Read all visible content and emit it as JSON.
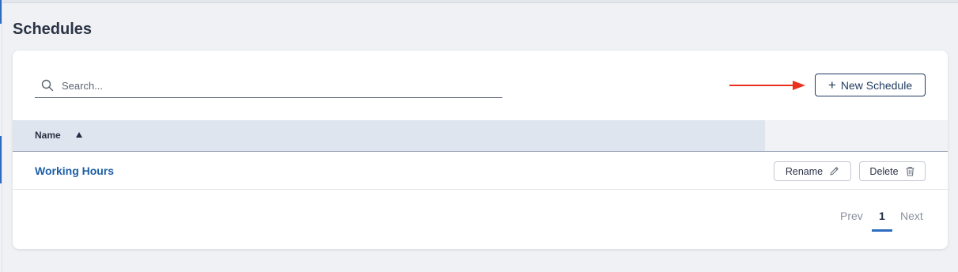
{
  "page": {
    "title": "Schedules"
  },
  "search": {
    "placeholder": "Search...",
    "value": ""
  },
  "toolbar": {
    "new_schedule_label": "New Schedule"
  },
  "table": {
    "columns": [
      {
        "label": "Name",
        "sort": "ascending"
      }
    ],
    "rows": [
      {
        "name": "Working Hours",
        "rename_label": "Rename",
        "delete_label": "Delete"
      }
    ]
  },
  "pagination": {
    "prev_label": "Prev",
    "current_page": "1",
    "next_label": "Next"
  },
  "colors": {
    "accent": "#2d6cc0",
    "link": "#1d5fa6",
    "annotation_arrow": "#e8321e"
  },
  "icons": [
    "search-icon",
    "plus-icon",
    "sort-ascending-icon",
    "pencil-icon",
    "trash-icon",
    "arrow-right-icon"
  ]
}
